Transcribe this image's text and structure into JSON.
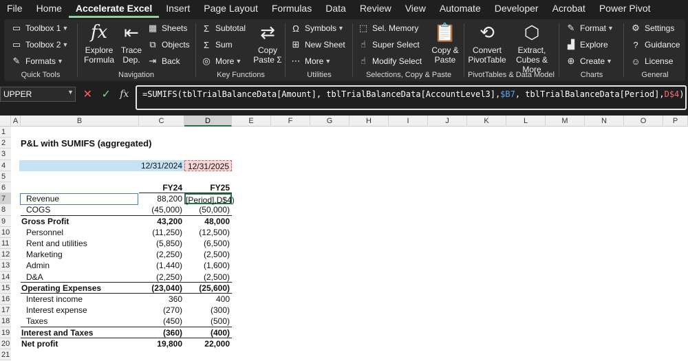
{
  "menu": [
    "File",
    "Home",
    "Accelerate Excel",
    "Insert",
    "Page Layout",
    "Formulas",
    "Data",
    "Review",
    "View",
    "Automate",
    "Developer",
    "Acrobat",
    "Power Pivot"
  ],
  "ribbon": {
    "quick_tools": {
      "label": "Quick Tools",
      "toolbox1": "Toolbox 1",
      "toolbox2": "Toolbox 2",
      "formats": "Formats"
    },
    "navigation": {
      "label": "Navigation",
      "explore_formula": "Explore Formula",
      "trace_dep": "Trace Dep.",
      "sheets": "Sheets",
      "objects": "Objects",
      "back": "Back"
    },
    "key_functions": {
      "label": "Key Functions",
      "subtotal": "Subtotal",
      "sum": "Sum",
      "more": "More",
      "copy_paste": "Copy Paste Σ"
    },
    "utilities": {
      "label": "Utilities",
      "symbols": "Symbols",
      "new_sheet": "New Sheet",
      "more": "More"
    },
    "selections": {
      "label": "Selections, Copy & Paste",
      "sel_memory": "Sel. Memory",
      "super_select": "Super Select",
      "modify_select": "Modify Select",
      "copy_paste": "Copy & Paste"
    },
    "pivot": {
      "label": "PivotTables & Data Model",
      "convert": "Convert PivotTable",
      "extract": "Extract, Cubes & More"
    },
    "charts": {
      "label": "Charts",
      "format": "Format",
      "explore": "Explore",
      "create": "Create"
    },
    "general": {
      "label": "General",
      "settings": "Settings",
      "guidance": "Guidance",
      "license": "License"
    }
  },
  "formula_bar": {
    "name_box": "UPPER",
    "f1": "=SUMIFS(tblTrialBalanceData[Amount], tblTrialBalanceData[AccountLevel3],",
    "f2": "$B7",
    "f3": ", tblTrialBalanceData[Period],",
    "f4": "D$4",
    "f5": ")"
  },
  "columns": [
    "A",
    "B",
    "C",
    "D",
    "E",
    "F",
    "G",
    "H",
    "I",
    "J",
    "K",
    "L",
    "M",
    "N",
    "O",
    "P"
  ],
  "rows": [
    "1",
    "2",
    "3",
    "4",
    "5",
    "6",
    "7",
    "8",
    "9",
    "10",
    "11",
    "12",
    "13",
    "14",
    "15",
    "16",
    "17",
    "18",
    "19",
    "20",
    "21"
  ],
  "sheet": {
    "title": "P&L with SUMIFS (aggregated)",
    "date1": "12/31/2024",
    "date2": "12/31/2025",
    "fy1": "FY24",
    "fy2": "FY25",
    "editing": "[Period],D$4)",
    "lines": [
      {
        "label": "Revenue",
        "c": "88,200",
        "d": "",
        "bold": false
      },
      {
        "label": "COGS",
        "c": "(45,000)",
        "d": "(50,000)",
        "bold": false
      },
      {
        "label": "Gross Profit",
        "c": "43,200",
        "d": "48,000",
        "bold": true
      },
      {
        "label": "Personnel",
        "c": "(11,250)",
        "d": "(12,500)",
        "bold": false
      },
      {
        "label": "Rent and utilities",
        "c": "(5,850)",
        "d": "(6,500)",
        "bold": false
      },
      {
        "label": "Marketing",
        "c": "(2,250)",
        "d": "(2,500)",
        "bold": false
      },
      {
        "label": "Admin",
        "c": "(1,440)",
        "d": "(1,600)",
        "bold": false
      },
      {
        "label": "D&A",
        "c": "(2,250)",
        "d": "(2,500)",
        "bold": false
      },
      {
        "label": "Operating Expenses",
        "c": "(23,040)",
        "d": "(25,600)",
        "bold": true
      },
      {
        "label": "Interest income",
        "c": "360",
        "d": "400",
        "bold": false
      },
      {
        "label": "Interest expense",
        "c": "(270)",
        "d": "(300)",
        "bold": false
      },
      {
        "label": "Taxes",
        "c": "(450)",
        "d": "(500)",
        "bold": false
      },
      {
        "label": "Interest and Taxes",
        "c": "(360)",
        "d": "(400)",
        "bold": true
      },
      {
        "label": "Net profit",
        "c": "19,800",
        "d": "22,000",
        "bold": true
      }
    ]
  }
}
